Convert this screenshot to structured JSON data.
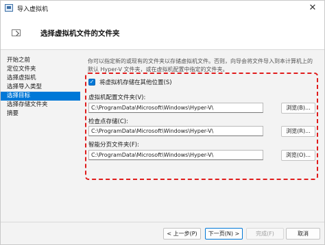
{
  "window": {
    "title": "导入虚拟机",
    "close_glyph": "✕"
  },
  "header": {
    "title": "选择虚拟机文件的文件夹"
  },
  "nav": {
    "items": [
      {
        "label": "开始之前"
      },
      {
        "label": "定位文件夹"
      },
      {
        "label": "选择虚拟机"
      },
      {
        "label": "选择导入类型"
      },
      {
        "label": "选择目标"
      },
      {
        "label": "选择存储文件夹"
      },
      {
        "label": "摘要"
      }
    ],
    "active_index": 4
  },
  "content": {
    "description_line1": "你可以指定新的或现有的文件夹以存储虚拟机文件。否则，向导会将文件导入到本计算机上的",
    "description_line2": "默认 Hyper-V 文件夹，或在虚拟机配置中指定的文件夹。",
    "checkbox_label": "将虚拟机存储在其他位置(S)",
    "checkbox_checked": true,
    "check_glyph": "✓",
    "fields": [
      {
        "label": "虚拟机配置文件夹(V):",
        "value": "C:\\ProgramData\\Microsoft\\Windows\\Hyper-V\\",
        "button": "浏览(B)..."
      },
      {
        "label": "检查点存储(C):",
        "value": "C:\\ProgramData\\Microsoft\\Windows\\Hyper-V\\",
        "button": "浏览(R)..."
      },
      {
        "label": "智能分页文件夹(F):",
        "value": "C:\\ProgramData\\Microsoft\\Windows\\Hyper-V\\",
        "button": "浏览(O)..."
      }
    ]
  },
  "footer": {
    "prev_label": "< 上一步(P)",
    "next_label": "下一页(N) >",
    "finish_label": "完成(F)",
    "cancel_label": "取消"
  },
  "colors": {
    "accent": "#0078d7",
    "highlight_border": "#e01b1b"
  }
}
